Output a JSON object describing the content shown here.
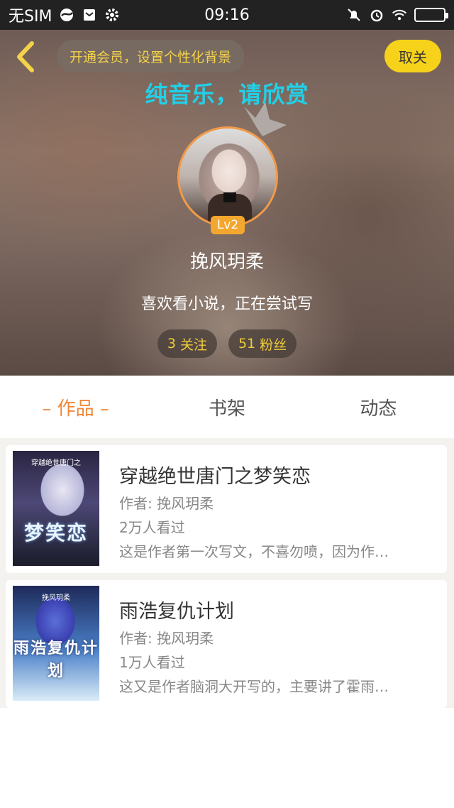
{
  "status_bar": {
    "carrier": "无SIM",
    "time": "09:16"
  },
  "header": {
    "vip_prompt": "开通会员，设置个性化背景",
    "unfollow_label": "取关",
    "music_banner": "纯音乐，请欣赏",
    "level": "Lv2",
    "username": "挽风玥柔",
    "bio": "喜欢看小说，正在尝试写",
    "following": {
      "count": "3",
      "label": "关注"
    },
    "followers": {
      "count": "51",
      "label": "粉丝"
    }
  },
  "tabs": [
    {
      "label": "– 作品 –",
      "active": true
    },
    {
      "label": "书架",
      "active": false
    },
    {
      "label": "动态",
      "active": false
    }
  ],
  "books": [
    {
      "title": "穿越绝世唐门之梦笑恋",
      "author": "作者: 挽风玥柔",
      "views": "2万人看过",
      "description": "这是作者第一次写文，不喜勿喷，因为作…",
      "cover_text": "梦笑恋",
      "cover_subtitle": "穿越绝世唐门之"
    },
    {
      "title": "雨浩复仇计划",
      "author": "作者: 挽风玥柔",
      "views": "1万人看过",
      "description": "这又是作者脑洞大开写的，主要讲了霍雨…",
      "cover_text": "雨浩复仇计划",
      "cover_subtitle": "挽风玥柔"
    }
  ],
  "colors": {
    "accent": "#f0883a",
    "vip_text": "#f3d24a",
    "banner": "#22d0e8",
    "unfollow_bg": "#f7d21a"
  }
}
